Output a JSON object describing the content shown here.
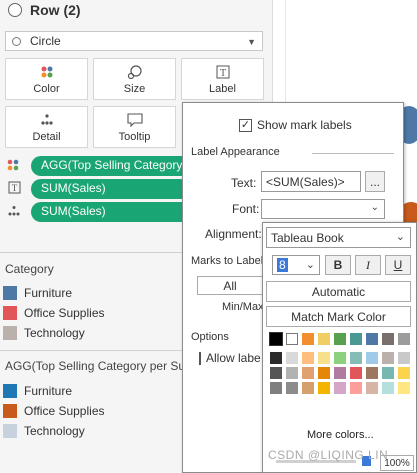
{
  "marks_card": {
    "row_title": "Row (2)",
    "mark_type": "Circle",
    "tiles": [
      {
        "label": "Color",
        "icon": "color-dots-icon"
      },
      {
        "label": "Size",
        "icon": "size-icon"
      },
      {
        "label": "Label",
        "icon": "label-T-icon"
      },
      {
        "label": "Detail",
        "icon": "detail-dots-icon"
      },
      {
        "label": "Tooltip",
        "icon": "tooltip-icon"
      }
    ],
    "pills": [
      {
        "icon": "color-dots-icon",
        "label": "AGG(Top Selling Category per Sub-Category)"
      },
      {
        "icon": "label-T-icon",
        "label": "SUM(Sales)"
      },
      {
        "icon": "detail-dots-icon",
        "label": "SUM(Sales)"
      }
    ]
  },
  "legend1": {
    "title": "Category",
    "items": [
      {
        "label": "Furniture",
        "color": "#4e79a7"
      },
      {
        "label": "Office Supplies",
        "color": "#e15759"
      },
      {
        "label": "Technology",
        "color": "#bab0ac"
      }
    ]
  },
  "legend2": {
    "title": "AGG(Top Selling Category per Sub-Category)",
    "items": [
      {
        "label": "Furniture",
        "color": "#1f77b4"
      },
      {
        "label": "Office Supplies",
        "color": "#c85a1c"
      },
      {
        "label": "Technology",
        "color": "#c8d2dc"
      }
    ]
  },
  "label_dialog": {
    "show_mark_labels": "Show mark labels",
    "show_mark_labels_checked": true,
    "label_appearance": "Label Appearance",
    "text_label": "Text:",
    "text_value": "<SUM(Sales)>",
    "ellipsis": "...",
    "font_label": "Font:",
    "alignment_label": "Alignment:",
    "marks_to_label": "Marks to Label",
    "all_option": "All",
    "minmax": "Min/Max",
    "options": "Options",
    "allow_labels": "Allow labels to overlap other marks"
  },
  "font_popup": {
    "font_family": "Tableau Book",
    "font_size": "8",
    "bold": "B",
    "italic": "I",
    "underline": "U",
    "automatic": "Automatic",
    "match_mark_color": "Match Mark Color",
    "more_colors": "More colors...",
    "opacity": "100%",
    "palette_columns": [
      [
        "#000000",
        "#2b2b2b",
        "#555555",
        "#7f7f7f"
      ],
      [
        "#ffffff",
        "#d9d9d9",
        "#b2b2b2",
        "#8c8c8c"
      ],
      [
        "#f28e2b",
        "#ffbe7d",
        "#e0a070",
        "#d6a06c"
      ],
      [
        "#f1ce63",
        "#f7e08a",
        "#e58606",
        "#f4b400"
      ],
      [
        "#59a14f",
        "#8cd17d",
        "#b07aa1",
        "#d4a6c8"
      ],
      [
        "#499894",
        "#86bcb6",
        "#e15759",
        "#ff9d9a"
      ],
      [
        "#4e79a7",
        "#a0cbe8",
        "#9d7660",
        "#d7b5a6"
      ],
      [
        "#79706e",
        "#bab0ac",
        "#76b7b2",
        "#b3e0dd"
      ],
      [
        "#9c9c9c",
        "#c9c9c9",
        "#fbd34d",
        "#ffe680"
      ]
    ]
  },
  "watermark": "CSDN @LIQING LIN"
}
